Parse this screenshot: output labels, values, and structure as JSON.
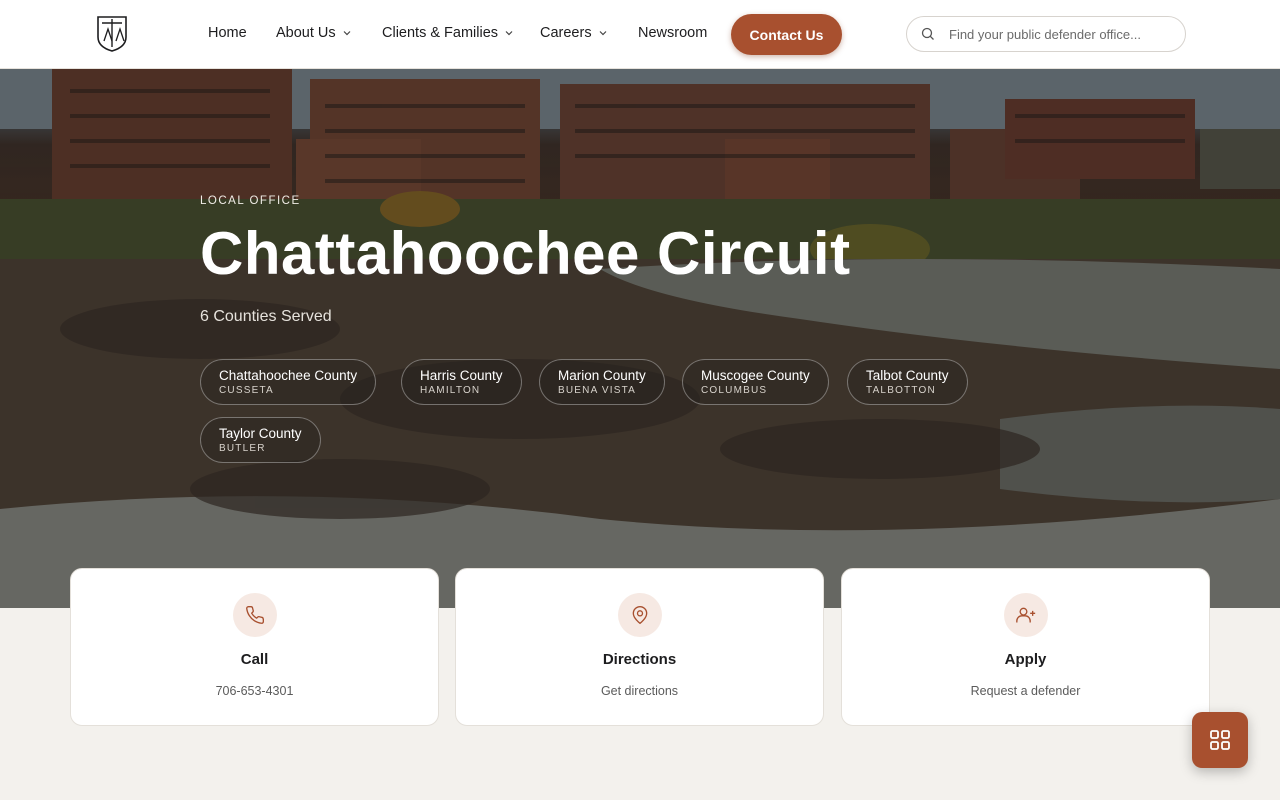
{
  "header": {
    "nav": {
      "home": "Home",
      "about": "About Us",
      "clients": "Clients & Families",
      "careers": "Careers",
      "newsroom": "Newsroom"
    },
    "contact_label": "Contact Us",
    "search_placeholder": "Find your public defender office..."
  },
  "hero": {
    "eyebrow": "LOCAL OFFICE",
    "title": "Chattahoochee Circuit",
    "counties_served": "6 Counties Served",
    "counties": [
      {
        "name": "Chattahoochee County",
        "seat": "CUSSETA"
      },
      {
        "name": "Harris County",
        "seat": "HAMILTON"
      },
      {
        "name": "Marion County",
        "seat": "BUENA VISTA"
      },
      {
        "name": "Muscogee County",
        "seat": "COLUMBUS"
      },
      {
        "name": "Talbot County",
        "seat": "TALBOTTON"
      },
      {
        "name": "Taylor County",
        "seat": "BUTLER"
      }
    ]
  },
  "cards": [
    {
      "title": "Call",
      "subtitle": "706-653-4301",
      "icon": "phone-icon"
    },
    {
      "title": "Directions",
      "subtitle": "Get directions",
      "icon": "map-pin-icon"
    },
    {
      "title": "Apply",
      "subtitle": "Request a defender",
      "icon": "user-plus-icon"
    }
  ],
  "colors": {
    "accent": "#a8502f",
    "accent_light": "#f6e9e3",
    "page_bg": "#f3f1ed"
  },
  "fab_icon": "grid-icon"
}
